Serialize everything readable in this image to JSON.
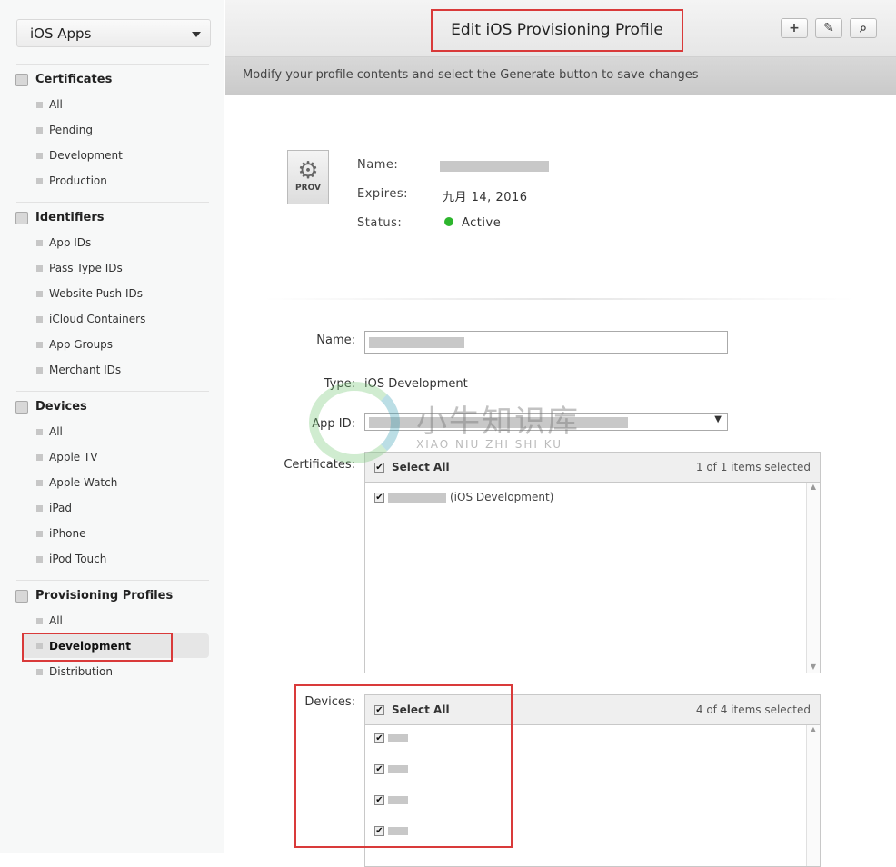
{
  "sidebar": {
    "platform": "iOS Apps",
    "sections": [
      {
        "title": "Certificates",
        "icon": "certificate-icon",
        "items": [
          "All",
          "Pending",
          "Development",
          "Production"
        ]
      },
      {
        "title": "Identifiers",
        "icon": "id-icon",
        "items": [
          "App IDs",
          "Pass Type IDs",
          "Website Push IDs",
          "iCloud Containers",
          "App Groups",
          "Merchant IDs"
        ]
      },
      {
        "title": "Devices",
        "icon": "device-icon",
        "items": [
          "All",
          "Apple TV",
          "Apple Watch",
          "iPad",
          "iPhone",
          "iPod Touch"
        ]
      },
      {
        "title": "Provisioning Profiles",
        "icon": "document-icon",
        "items": [
          "All",
          "Development",
          "Distribution"
        ]
      }
    ],
    "selected": "Development"
  },
  "header": {
    "title": "Edit iOS Provisioning Profile",
    "buttons": {
      "add": "+",
      "edit": "edit-icon",
      "search": "search-icon"
    }
  },
  "subheader": "Modify your profile contents and select the Generate button to save changes",
  "summary": {
    "icon_label": "PROV",
    "name_label": "Name:",
    "expires_label": "Expires:",
    "expires": "九月 14, 2016",
    "status_label": "Status:",
    "status": "Active",
    "status_color": "#2db52d"
  },
  "form": {
    "name_label": "Name:",
    "type_label": "Type:",
    "type": "iOS Development",
    "appid_label": "App ID:",
    "certificates": {
      "label": "Certificates:",
      "select_all": "Select All",
      "count": "1 of 1 items selected",
      "items": [
        "(iOS Development)"
      ]
    },
    "devices": {
      "label": "Devices:",
      "select_all": "Select All",
      "count": "4 of 4 items selected",
      "count_items": 4
    }
  },
  "watermark": {
    "cn": "小牛知识库",
    "en": "XIAO NIU ZHI SHI KU"
  },
  "colors": {
    "highlight": "#d93a3a"
  }
}
